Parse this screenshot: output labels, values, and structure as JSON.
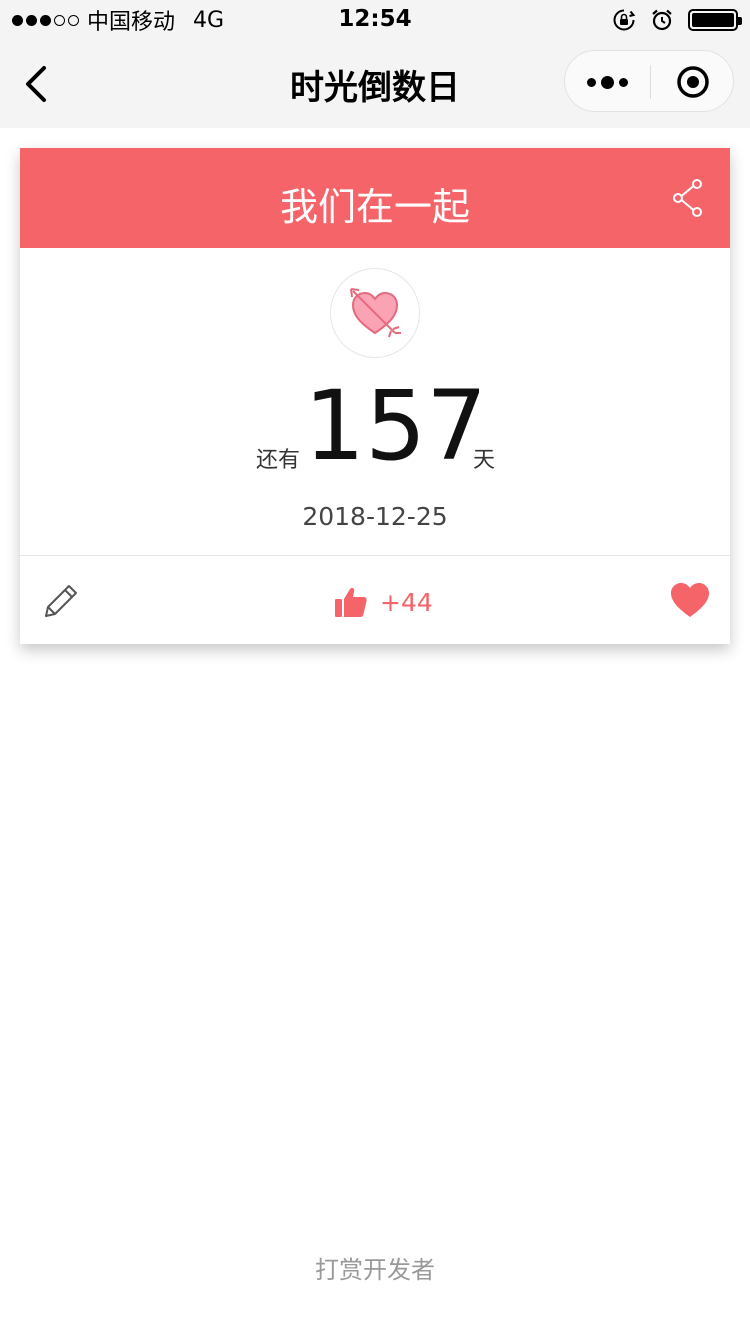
{
  "status_bar": {
    "carrier": "中国移动",
    "network": "4G",
    "time": "12:54",
    "signal_bars_filled": 3,
    "signal_bars_total": 5,
    "battery_level": 1.0,
    "icons": [
      "rotation-lock-icon",
      "alarm-icon",
      "battery-icon"
    ]
  },
  "nav": {
    "title": "时光倒数日",
    "back_icon": "chevron-left-icon",
    "more_icon": "more-dots-icon",
    "close_icon": "target-circle-icon"
  },
  "card": {
    "title": "我们在一起",
    "share_icon": "share-icon",
    "badge_icon": "heart-arrow-icon",
    "prefix": "还有",
    "count": "157",
    "suffix": "天",
    "date": "2018-12-25",
    "edit_icon": "pencil-icon",
    "like_icon": "thumbs-up-icon",
    "like_count": "+44",
    "favorite_icon": "heart-icon"
  },
  "footer": {
    "reward_link": "打赏开发者"
  },
  "colors": {
    "accent": "#f56468",
    "nav_background": "#f4f4f4",
    "text_primary": "#111111",
    "text_muted": "#999999"
  }
}
